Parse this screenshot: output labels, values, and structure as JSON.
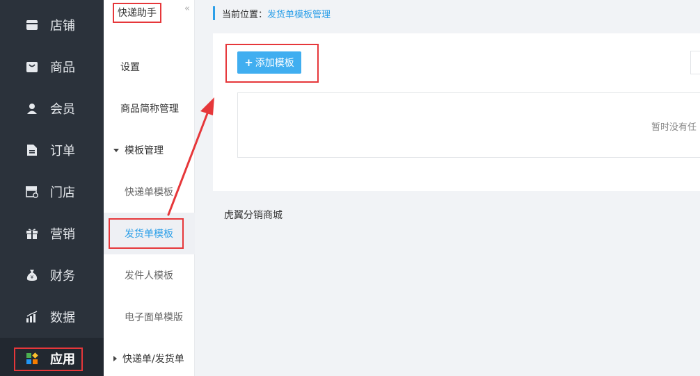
{
  "main_nav": {
    "items": [
      {
        "label": "店铺",
        "icon": "store-icon"
      },
      {
        "label": "商品",
        "icon": "bag-icon"
      },
      {
        "label": "会员",
        "icon": "user-icon"
      },
      {
        "label": "订单",
        "icon": "document-icon"
      },
      {
        "label": "门店",
        "icon": "shop-front-icon"
      },
      {
        "label": "营销",
        "icon": "gift-icon"
      },
      {
        "label": "财务",
        "icon": "money-bag-icon"
      },
      {
        "label": "数据",
        "icon": "bar-chart-icon"
      },
      {
        "label": "应用",
        "icon": "apps-icon",
        "active": true
      }
    ]
  },
  "sub_nav": {
    "title": "快递助手",
    "collapse": "«",
    "items": [
      {
        "label": "设置"
      },
      {
        "label": "商品简称管理"
      },
      {
        "label": "模板管理"
      },
      {
        "label": "快递单模板"
      },
      {
        "label": "发货单模板"
      },
      {
        "label": "发件人模板"
      },
      {
        "label": "电子面单模版"
      },
      {
        "label": "快递单/发货单"
      }
    ]
  },
  "breadcrumb": {
    "prefix": "当前位置：",
    "current": "发货单模板管理"
  },
  "toolbar": {
    "add_icon": "+",
    "add_label": "添加模板"
  },
  "table": {
    "empty_text": "暂时没有任"
  },
  "footer": {
    "text": "虎翼分销商城"
  },
  "colors": {
    "sidebar_bg": "#2b323b",
    "accent": "#2c9fe8",
    "button": "#40aef0",
    "annotation": "#e6373a"
  }
}
